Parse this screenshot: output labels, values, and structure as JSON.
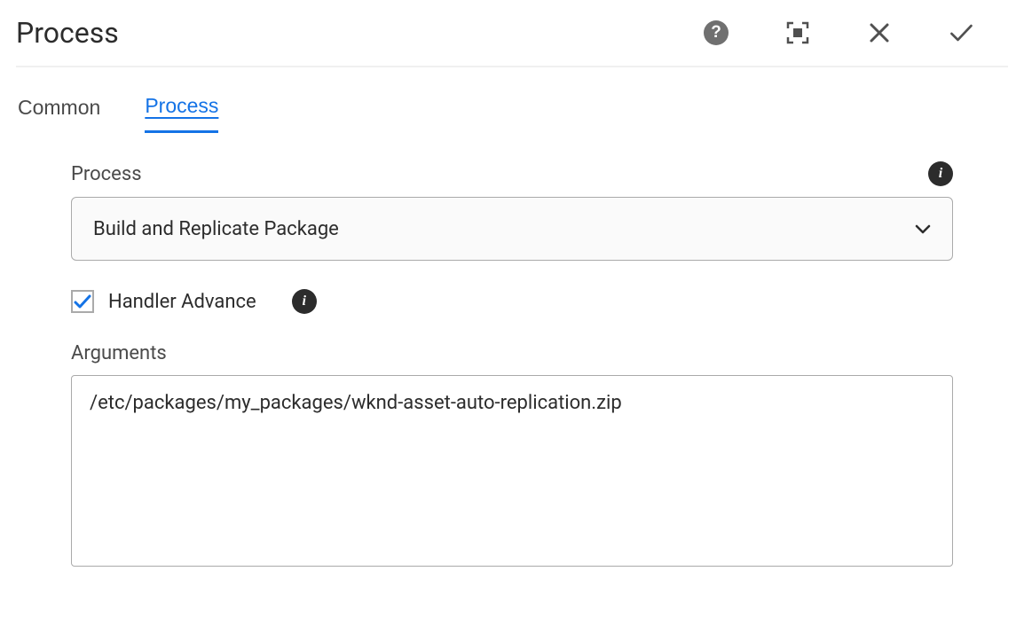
{
  "header": {
    "title": "Process"
  },
  "tabs": [
    {
      "label": "Common",
      "active": false
    },
    {
      "label": "Process",
      "active": true
    }
  ],
  "form": {
    "process": {
      "label": "Process",
      "value": "Build and Replicate Package"
    },
    "handlerAdvance": {
      "label": "Handler Advance",
      "checked": true
    },
    "arguments": {
      "label": "Arguments",
      "value": "/etc/packages/my_packages/wknd-asset-auto-replication.zip"
    }
  }
}
